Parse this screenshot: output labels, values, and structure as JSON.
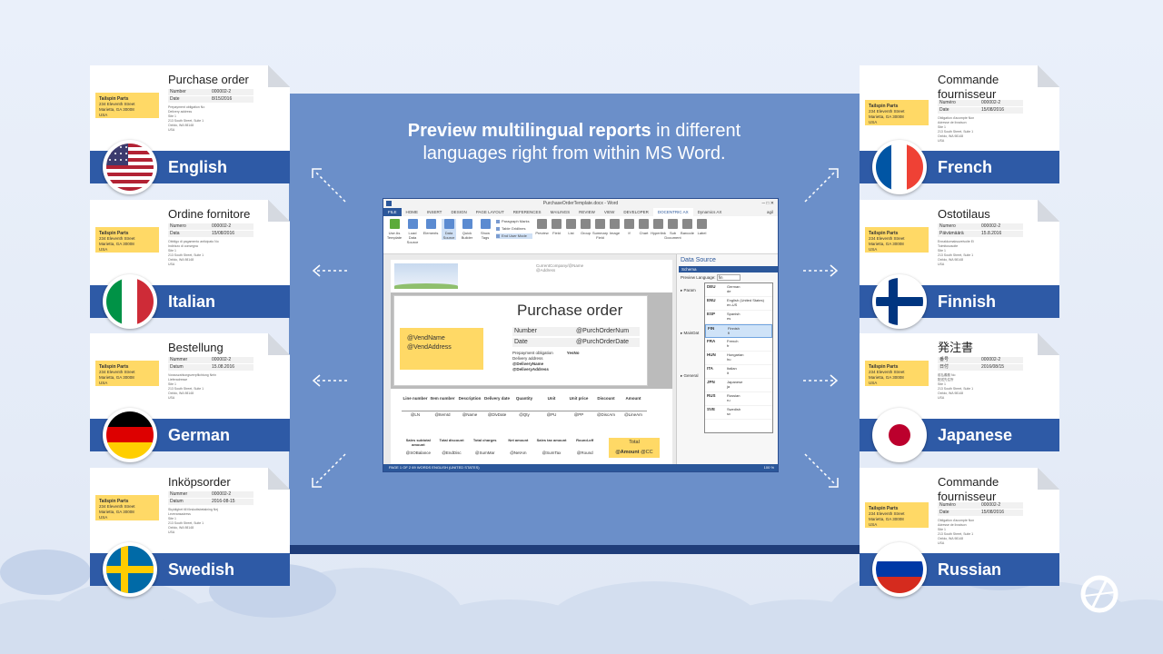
{
  "headline": {
    "bold": "Preview multilingual reports",
    "rest_line1": " in different",
    "line2": "languages right from within MS Word."
  },
  "sample_vendor": {
    "name": "Tailspin Parts",
    "street": "234 Eleventh Street",
    "city": "Marietta, GA 30008",
    "country": "USA"
  },
  "sample_delivery": [
    "Site 1",
    "213 South Street, Suite 1",
    "Oxfolo, WA 98148",
    "USA"
  ],
  "cards": [
    {
      "lang": "English",
      "title": "Purchase order",
      "l1": "Number",
      "v1": "000002-2",
      "l2": "Date",
      "v2": "8/15/2016",
      "extra": "Prepayment obligation   No\nDelivery address"
    },
    {
      "lang": "Italian",
      "title": "Ordine fornitore",
      "l1": "Numero",
      "v1": "000002-2",
      "l2": "Data",
      "v2": "15/08/2016",
      "extra": "Obbligo di pagamento anticipato   No\nIndirizzo di consegna"
    },
    {
      "lang": "German",
      "title": "Bestellung",
      "l1": "Nummer",
      "v1": "000002-2",
      "l2": "Datum",
      "v2": "15.08.2016",
      "extra": "Vorauszahlungsverpflichtung   Nein\nLieferadresse"
    },
    {
      "lang": "Swedish",
      "title": "Inköpsorder",
      "l1": "Nummer",
      "v1": "000002-2",
      "l2": "Datum",
      "v2": "2016-08-15",
      "extra": "Skyldighet till förskottsbetalning   Nej\nLeveransadress"
    },
    {
      "lang": "French",
      "title": "Commande fournisseur",
      "l1": "Numéro",
      "v1": "000002-2",
      "l2": "Date",
      "v2": "15/08/2016",
      "extra": "Obligation d'acompte   Non\nAdresse de livraison"
    },
    {
      "lang": "Finnish",
      "title": "Ostotilaus",
      "l1": "Numero",
      "v1": "000002-2",
      "l2": "Päivämäärä",
      "v2": "15.8.2016",
      "extra": "Ennakkomaksuvelvoite   Ei\nToimitusosoite"
    },
    {
      "lang": "Japanese",
      "title": "発注書",
      "l1": "番号",
      "v1": "000002-2",
      "l2": "日付",
      "v2": "2016/08/15",
      "extra": "前払義務   No\n配送先住所"
    },
    {
      "lang": "Russian",
      "title": "Commande fournisseur",
      "l1": "Numéro",
      "v1": "000002-2",
      "l2": "Date",
      "v2": "15/08/2016",
      "extra": "Obligation d'acompte   Non\nAdresse de livraison"
    }
  ],
  "word": {
    "window_title": "PurchaseOrderTemplate.docx - Word",
    "tabs": [
      "FILE",
      "HOME",
      "INSERT",
      "DESIGN",
      "PAGE LAYOUT",
      "REFERENCES",
      "MAILINGS",
      "REVIEW",
      "VIEW",
      "DEVELOPER",
      "DOCENTRIC AX",
      "Dynamics AX"
    ],
    "user": "agil",
    "ribbon_buttons": [
      "Use As Template",
      "Load Data Source",
      "Elements",
      "Data Source",
      "Quick Builder",
      "Show Tags"
    ],
    "ribbon_checks": [
      "Paragraph Marks",
      "Table Gridlines",
      "End User Mode"
    ],
    "ribbon_buttons2": [
      "Preview",
      "Field",
      "List",
      "Group",
      "Summary Field",
      "Image",
      "If",
      "Chart",
      "Hyperlink",
      "Sub Document",
      "Barcode",
      "Label"
    ],
    "page": {
      "company": "CurrentCompany/@Name",
      "company_sub": "@Address",
      "title": "Purchase order",
      "vend_name": "@VendName",
      "vend_address": "@VendAddress",
      "number_label": "Number",
      "number_value": "@PurchOrderNum",
      "date_label": "Date",
      "date_value": "@PurchOrderDate",
      "prepay_label": "Prepayment obligation",
      "prepay_value": "YesNo",
      "delivery_label": "Delivery address",
      "delivery_name": "@DeliveryName",
      "delivery_address": "@DeliveryAddress",
      "line_headers": [
        "Line number",
        "Item number",
        "Description",
        "Delivery date",
        "Quantity",
        "Unit",
        "Unit price",
        "Discount",
        "Amount"
      ],
      "line_values": [
        "@LN",
        "@ItemId",
        "@Name",
        "@DlvDate",
        "@Qty",
        "@PU",
        "@PP",
        "@DiscAm",
        "@LineAm"
      ],
      "total_headers": [
        "Sales subtotal amount",
        "Total discount",
        "Total charges",
        "Net amount",
        "Sales tax amount",
        "Round-off"
      ],
      "total_values": [
        "@SOBalance",
        "@EndDisc",
        "@SumMar",
        "@NetAm",
        "@SumTax",
        "@Round"
      ],
      "total_label": "Total",
      "total_value": "@Amount",
      "total_cur": "@CC"
    },
    "status": "PAGE 1 OF 2    69 WORDS    ENGLISH (UNITED STATES)",
    "zoom": "100 %",
    "data_source": {
      "title": "Data Source",
      "schema": "Schema",
      "preview_label": "Preview Language:",
      "preview_value": "fin",
      "tree": [
        "Param",
        "MainDat",
        "General"
      ],
      "languages": [
        {
          "code": "DEU",
          "name": "German",
          "sub": "de"
        },
        {
          "code": "ENU",
          "name": "English (United States)",
          "sub": "en-US"
        },
        {
          "code": "ESP",
          "name": "Spanish",
          "sub": "es"
        },
        {
          "code": "FIN",
          "name": "Finnish",
          "sub": "fi"
        },
        {
          "code": "FRA",
          "name": "French",
          "sub": "fr"
        },
        {
          "code": "HUN",
          "name": "Hungarian",
          "sub": "hu"
        },
        {
          "code": "ITA",
          "name": "Italian",
          "sub": "it"
        },
        {
          "code": "JPN",
          "name": "Japanese",
          "sub": "ja"
        },
        {
          "code": "RUS",
          "name": "Russian",
          "sub": "ru"
        },
        {
          "code": "SVE",
          "name": "Swedish",
          "sub": "sv"
        }
      ]
    }
  },
  "colors": {
    "panel": "#6b8fc9",
    "band": "#2e5aa6",
    "highlight": "#ffd966",
    "word_blue": "#2b579a"
  }
}
